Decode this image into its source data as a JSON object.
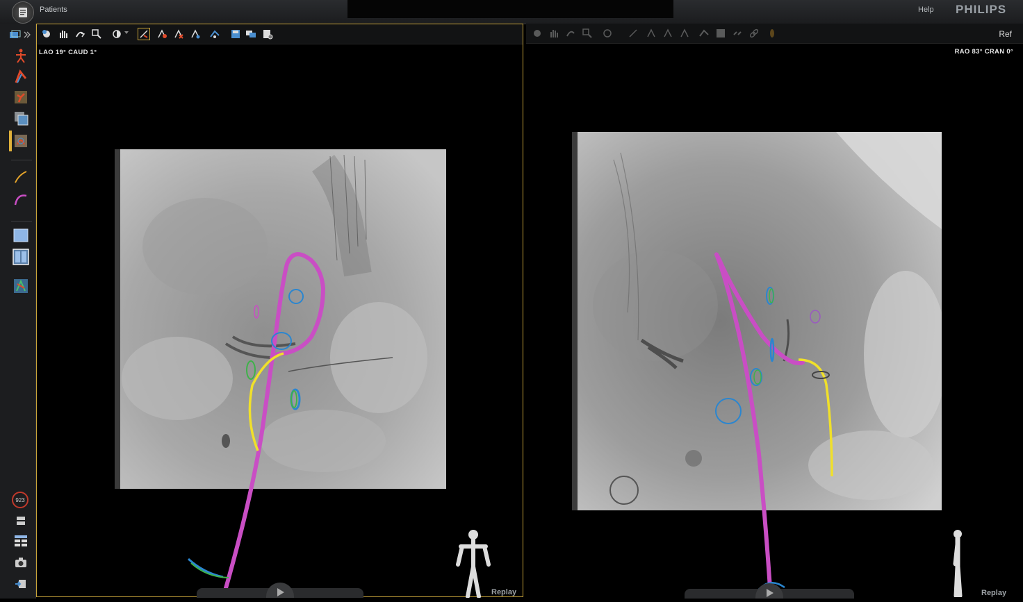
{
  "header": {
    "patients_label": "Patients",
    "help_label": "Help",
    "brand": "PHILIPS"
  },
  "left_view": {
    "angle_text": "LAO  19° CAUD   1°",
    "replay_label": "Replay"
  },
  "right_view": {
    "angle_text": "RAO  83° CRAN   0°",
    "ref_label": "Ref",
    "replay_label": "Replay"
  },
  "sidebar": {
    "counter_value": "923"
  },
  "colors": {
    "catheter_magenta": "#c94ec4",
    "wire_yellow": "#f0e02a",
    "ring_blue": "#2a86d0",
    "ring_green": "#3fb24a",
    "active_border": "#c9a53a"
  }
}
